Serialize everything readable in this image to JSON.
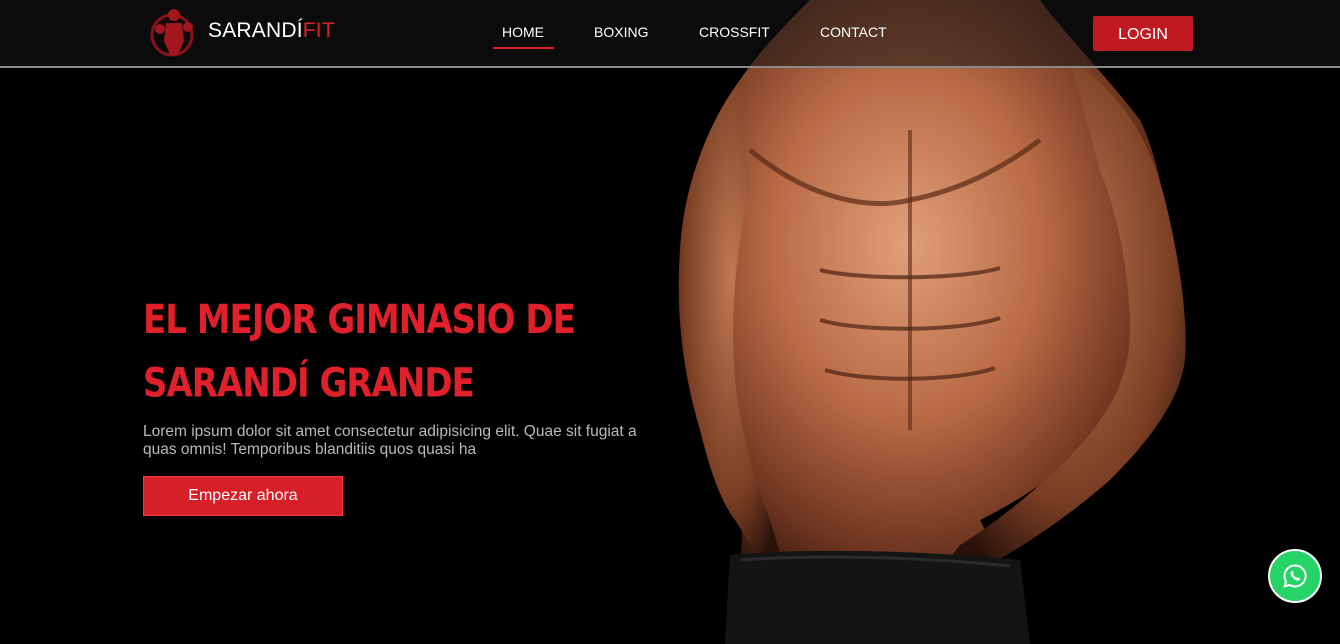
{
  "brand": {
    "name_main": "SARANDÍ",
    "name_accent": "FIT",
    "logo_icon": "boxer-logo-icon"
  },
  "nav": {
    "items": [
      {
        "label": "HOME",
        "active": true
      },
      {
        "label": "BOXING",
        "active": false
      },
      {
        "label": "CROSSFIT",
        "active": false
      },
      {
        "label": "CONTACT",
        "active": false
      }
    ],
    "login_label": "LOGIN"
  },
  "hero": {
    "title": "EL MEJOR GIMNASIO DE SARANDÍ GRANDE",
    "text": "Lorem ipsum dolor sit amet consectetur adipisicing elit. Quae sit fugiat a quas omnis! Temporibus blanditiis quos quasi ha",
    "cta_label": "Empezar ahora",
    "image": "muscular-torso-photo"
  },
  "whatsapp": {
    "icon": "whatsapp-icon"
  },
  "colors": {
    "accent": "#d9232b",
    "background": "#000000",
    "whatsapp": "#25d366"
  }
}
